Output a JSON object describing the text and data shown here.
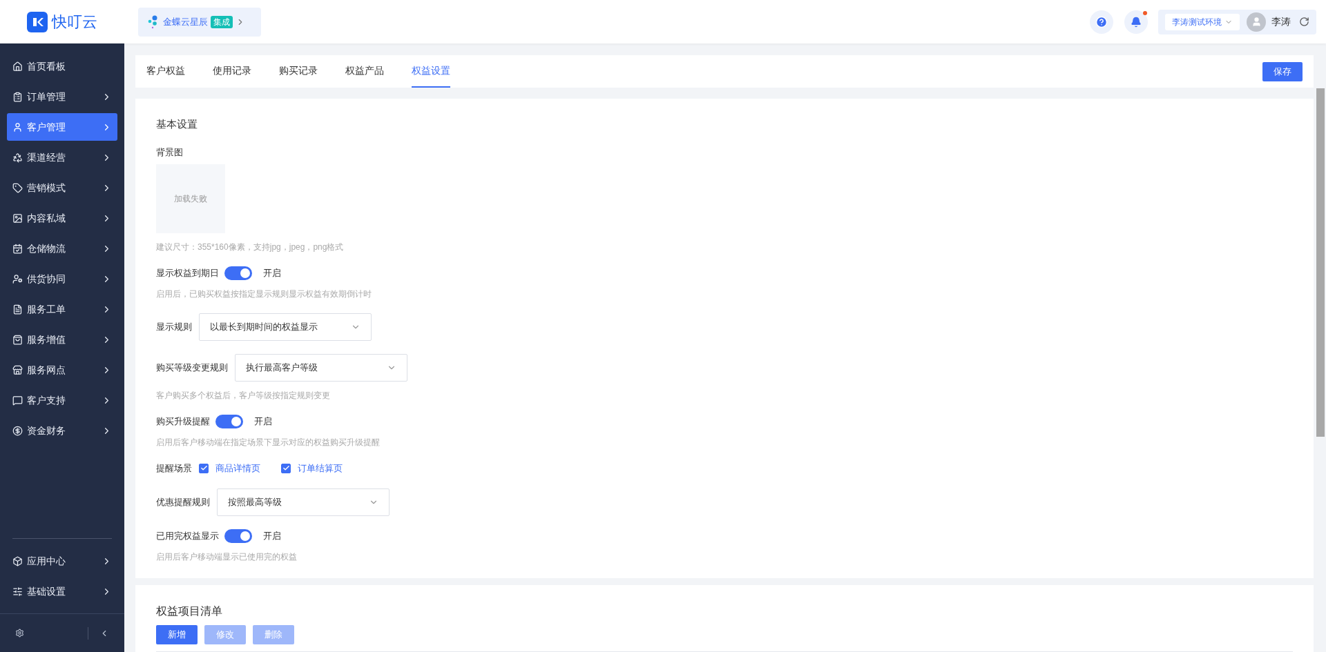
{
  "header": {
    "logo_text": "快叮云",
    "integration": {
      "name": "金蝶云星辰",
      "badge": "集成"
    },
    "environment": "李涛测试环境",
    "user_name": "李涛",
    "notification_unread": true
  },
  "sidebar": {
    "items": [
      {
        "label": "首页看板",
        "selected": false,
        "expandable": false
      },
      {
        "label": "订单管理",
        "selected": false,
        "expandable": true
      },
      {
        "label": "客户管理",
        "selected": true,
        "expandable": true
      },
      {
        "label": "渠道经营",
        "selected": false,
        "expandable": true
      },
      {
        "label": "营销模式",
        "selected": false,
        "expandable": true
      },
      {
        "label": "内容私域",
        "selected": false,
        "expandable": true
      },
      {
        "label": "仓储物流",
        "selected": false,
        "expandable": true
      },
      {
        "label": "供货协同",
        "selected": false,
        "expandable": true
      },
      {
        "label": "服务工单",
        "selected": false,
        "expandable": true
      },
      {
        "label": "服务增值",
        "selected": false,
        "expandable": true
      },
      {
        "label": "服务网点",
        "selected": false,
        "expandable": true
      },
      {
        "label": "客户支持",
        "selected": false,
        "expandable": true
      },
      {
        "label": "资金财务",
        "selected": false,
        "expandable": true
      }
    ],
    "bottom_items": [
      {
        "label": "应用中心",
        "selected": false,
        "expandable": true
      },
      {
        "label": "基础设置",
        "selected": false,
        "expandable": true
      }
    ]
  },
  "tabs": [
    {
      "label": "客户权益",
      "selected": false
    },
    {
      "label": "使用记录",
      "selected": false
    },
    {
      "label": "购买记录",
      "selected": false
    },
    {
      "label": "权益产品",
      "selected": false
    },
    {
      "label": "权益设置",
      "selected": true
    }
  ],
  "save_button": "保存",
  "basic_settings": {
    "title": "基本设置",
    "fields": [
      {
        "kind": "image",
        "label": "背景图",
        "image_status": "加载失败",
        "hint": "建议尺寸：355*160像素，支持jpg，jpeg，png格式"
      },
      {
        "kind": "toggle",
        "label": "显示权益到期日",
        "on": true,
        "status_text": "开启",
        "hint": "启用后，已购买权益按指定显示规则显示权益有效期倒计时"
      },
      {
        "kind": "select",
        "label": "显示规则",
        "value": "以最长到期时间的权益显示"
      },
      {
        "kind": "select",
        "label": "购买等级变更规则",
        "value": "执行最高客户等级",
        "hint": "客户购买多个权益后，客户等级按指定规则变更"
      },
      {
        "kind": "toggle",
        "label": "购买升级提醒",
        "on": true,
        "status_text": "开启",
        "hint": "启用后客户移动端在指定场景下显示对应的权益购买升级提醒"
      },
      {
        "kind": "checkboxes",
        "label": "提醒场景",
        "options": [
          {
            "label": "商品详情页",
            "checked": true
          },
          {
            "label": "订单结算页",
            "checked": true
          }
        ]
      },
      {
        "kind": "select",
        "label": "优惠提醒规则",
        "value": "按照最高等级"
      },
      {
        "kind": "toggle",
        "label": "已用完权益显示",
        "on": true,
        "status_text": "开启",
        "hint": "启用后客户移动端显示已使用完的权益"
      }
    ]
  },
  "items_list": {
    "title": "权益项目清单",
    "buttons": [
      {
        "label": "新增",
        "disabled": false
      },
      {
        "label": "修改",
        "disabled": true
      },
      {
        "label": "删除",
        "disabled": true
      }
    ]
  }
}
